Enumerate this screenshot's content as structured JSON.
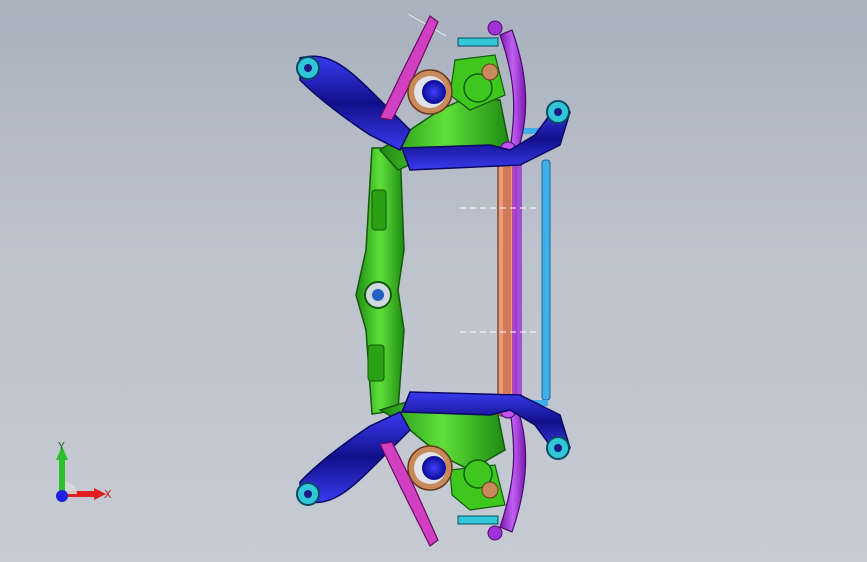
{
  "viewport": {
    "background_top": "#a9b1be",
    "background_bottom": "#c6cbd3"
  },
  "model": {
    "colors": {
      "subframe_green": "#3ec81e",
      "subframe_green_dark": "#1f8a12",
      "arm_blue": "#2a2ad8",
      "arm_blue_dark": "#10108a",
      "link_purple": "#a030d8",
      "link_magenta": "#d040c0",
      "bar_salmon": "#e89a7a",
      "stabilizer_cyan": "#3eaee8",
      "bushing_cyan": "#30c8d8",
      "spring_tan": "#c88a5a",
      "hub_blue": "#1818e0"
    },
    "part_icons": [
      "subframe-icon",
      "lower-arm-icon",
      "trailing-link-icon",
      "stabilizer-bar-icon",
      "spring-icon",
      "hub-icon"
    ]
  },
  "triad": {
    "y_label": "Y",
    "x_label": "X",
    "y_color": "#2cc02c",
    "x_color": "#e02020",
    "z_color": "#2020e0"
  }
}
